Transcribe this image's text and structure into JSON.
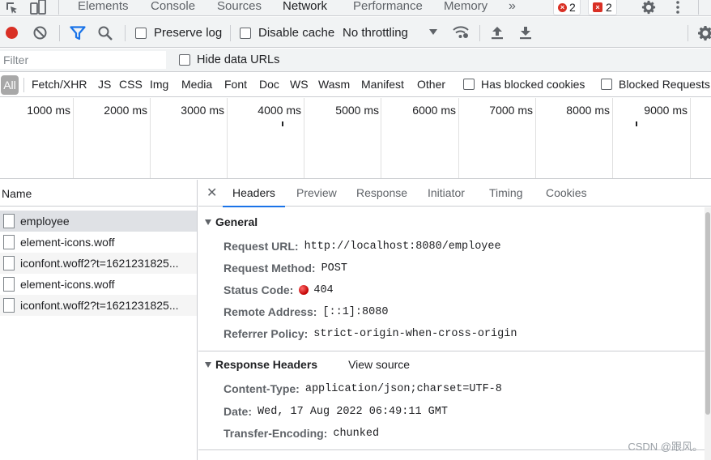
{
  "main_tabs": [
    "Elements",
    "Console",
    "Sources",
    "Network",
    "Performance",
    "Memory"
  ],
  "more_tabs_icon": "double-chevron-right-icon",
  "error_count": "2",
  "issue_count": "2",
  "toolbar": {
    "preserve_log": "Preserve log",
    "disable_cache": "Disable cache",
    "throttling": "No throttling"
  },
  "filter": {
    "placeholder": "Filter",
    "hide_data_urls": "Hide data URLs"
  },
  "type_filters": [
    "All",
    "Fetch/XHR",
    "JS",
    "CSS",
    "Img",
    "Media",
    "Font",
    "Doc",
    "WS",
    "Wasm",
    "Manifest",
    "Other"
  ],
  "blocked_cookies": "Has blocked cookies",
  "blocked_requests": "Blocked Requests",
  "timeline_labels": [
    "1000 ms",
    "2000 ms",
    "3000 ms",
    "4000 ms",
    "5000 ms",
    "6000 ms",
    "7000 ms",
    "8000 ms",
    "9000 ms"
  ],
  "list": {
    "header": "Name",
    "requests": [
      "employee",
      "element-icons.woff",
      "iconfont.woff2?t=1621231825...",
      "element-icons.woff",
      "iconfont.woff2?t=1621231825..."
    ]
  },
  "detail_tabs": [
    "Headers",
    "Preview",
    "Response",
    "Initiator",
    "Timing",
    "Cookies"
  ],
  "general": {
    "title": "General",
    "request_url_label": "Request URL:",
    "request_url": "http://localhost:8080/employee",
    "request_method_label": "Request Method:",
    "request_method": "POST",
    "status_code_label": "Status Code:",
    "status_code": "404",
    "remote_address_label": "Remote Address:",
    "remote_address": "[::1]:8080",
    "referrer_policy_label": "Referrer Policy:",
    "referrer_policy": "strict-origin-when-cross-origin"
  },
  "response_headers": {
    "title": "Response Headers",
    "view_source": "View source",
    "content_type_label": "Content-Type:",
    "content_type": "application/json;charset=UTF-8",
    "date_label": "Date:",
    "date": "Wed, 17 Aug 2022 06:49:11 GMT",
    "transfer_encoding_label": "Transfer-Encoding:",
    "transfer_encoding": "chunked"
  },
  "watermark": "CSDN @跟风。",
  "colors": {
    "accent": "#1a73e8",
    "error": "#d93025"
  }
}
